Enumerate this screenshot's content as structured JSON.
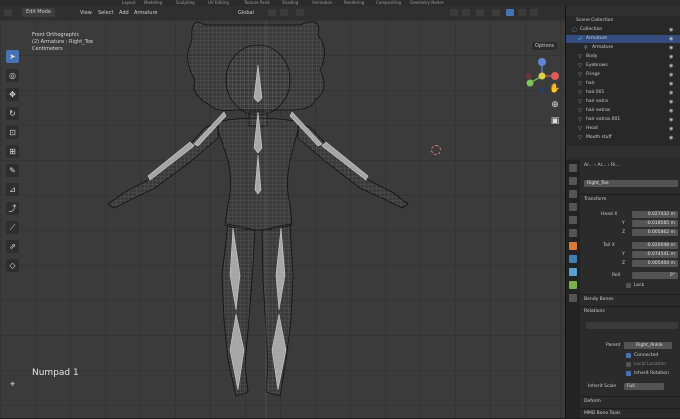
{
  "topbar": {
    "tabs": [
      "Layout",
      "Modeling",
      "Sculpting",
      "UV Editing",
      "Texture Paint",
      "Shading",
      "Animation",
      "Rendering",
      "Compositing",
      "Geometry Nodes"
    ]
  },
  "viewport_header": {
    "mode": "Edit Mode",
    "menus": [
      "View",
      "Select",
      "Add",
      "Armature"
    ],
    "transform_orientation": "Global",
    "options": "Options"
  },
  "viewport": {
    "view_name": "Front Orthographic",
    "object_info": "(2) Armature : Right_Toe",
    "units": "Centimeters",
    "numpad_hint": "Numpad 1"
  },
  "gizmo": {
    "x": "X",
    "y": "Y",
    "z": "Z"
  },
  "outliner": {
    "root": "Scene Collection",
    "items": [
      {
        "label": "Collection",
        "icon": "collection-icon",
        "selected": false,
        "indent": 1
      },
      {
        "label": "Armature",
        "icon": "armature-icon",
        "selected": true,
        "indent": 2
      },
      {
        "label": "Armature",
        "icon": "armature-data-icon",
        "selected": false,
        "indent": 3
      },
      {
        "label": "Body",
        "icon": "mesh-icon",
        "selected": false,
        "indent": 2
      },
      {
        "label": "Eyebrows",
        "icon": "mesh-icon",
        "selected": false,
        "indent": 2
      },
      {
        "label": "Fringe",
        "icon": "mesh-icon",
        "selected": false,
        "indent": 2
      },
      {
        "label": "hair",
        "icon": "mesh-icon",
        "selected": false,
        "indent": 2
      },
      {
        "label": "hair.001",
        "icon": "mesh-icon",
        "selected": false,
        "indent": 2
      },
      {
        "label": "hair extra",
        "icon": "mesh-icon",
        "selected": false,
        "indent": 2
      },
      {
        "label": "hair extras",
        "icon": "mesh-icon",
        "selected": false,
        "indent": 2
      },
      {
        "label": "hair extras.001",
        "icon": "mesh-icon",
        "selected": false,
        "indent": 2
      },
      {
        "label": "Head",
        "icon": "mesh-icon",
        "selected": false,
        "indent": 2
      },
      {
        "label": "Mouth stuff",
        "icon": "mesh-icon",
        "selected": false,
        "indent": 2
      }
    ]
  },
  "properties": {
    "breadcrumb": [
      "Ar...",
      "Ar...",
      "Ri..."
    ],
    "bone_name": "Right_Toe",
    "transform_header": "Transform",
    "head": {
      "label": "Head X",
      "x": "0.027432 m",
      "y_label": "Y",
      "y": "-0.018585 m",
      "z_label": "Z",
      "z": "0.005862 m"
    },
    "tail": {
      "label": "Tail X",
      "x": "-0.020048 m",
      "y_label": "Y",
      "y": "-0.074541 m",
      "z_label": "Z",
      "z": "0.005404 m"
    },
    "roll_label": "Roll",
    "roll_value": "0°",
    "lock_label": "Lock",
    "bendy_bones": "Bendy Bones",
    "relations": "Relations",
    "parent_label": "Parent",
    "parent_value": "Right_Ankle",
    "connected": "Connected",
    "local_location": "Local Location",
    "inherit_rotation": "Inherit Rotation",
    "inherit_scale_label": "Inherit Scale",
    "inherit_scale_value": "Full",
    "deform": "Deform",
    "bbone_tools": "MMD Bone Tools"
  }
}
